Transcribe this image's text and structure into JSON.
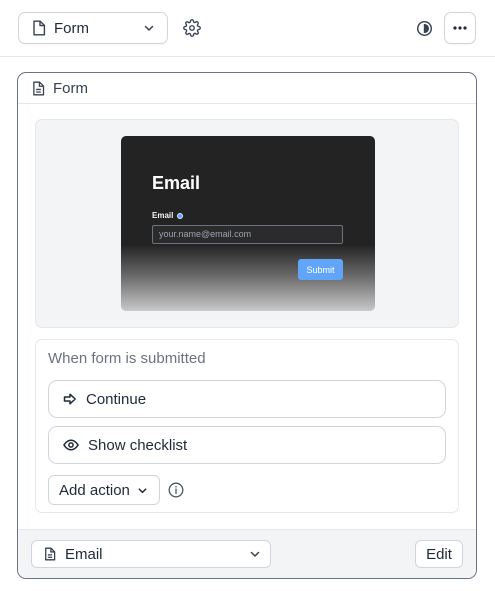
{
  "toolbar": {
    "block_type": "Form",
    "icons": [
      "document-icon",
      "chevron-down-icon",
      "gear-icon",
      "contrast-icon",
      "more-horizontal-icon"
    ]
  },
  "card": {
    "title": "Form",
    "preview": {
      "form_title": "Email",
      "field_label": "Email",
      "input_placeholder": "your.name@email.com",
      "submit_label": "Submit",
      "accent_color": "#60a5fa"
    },
    "actions": {
      "heading": "When form is submitted",
      "items": [
        {
          "label": "Continue",
          "icon": "arrow-right-icon"
        },
        {
          "label": "Show checklist",
          "icon": "eye-icon"
        }
      ],
      "add_label": "Add action"
    },
    "footer": {
      "selected_field": "Email",
      "edit_label": "Edit"
    }
  }
}
